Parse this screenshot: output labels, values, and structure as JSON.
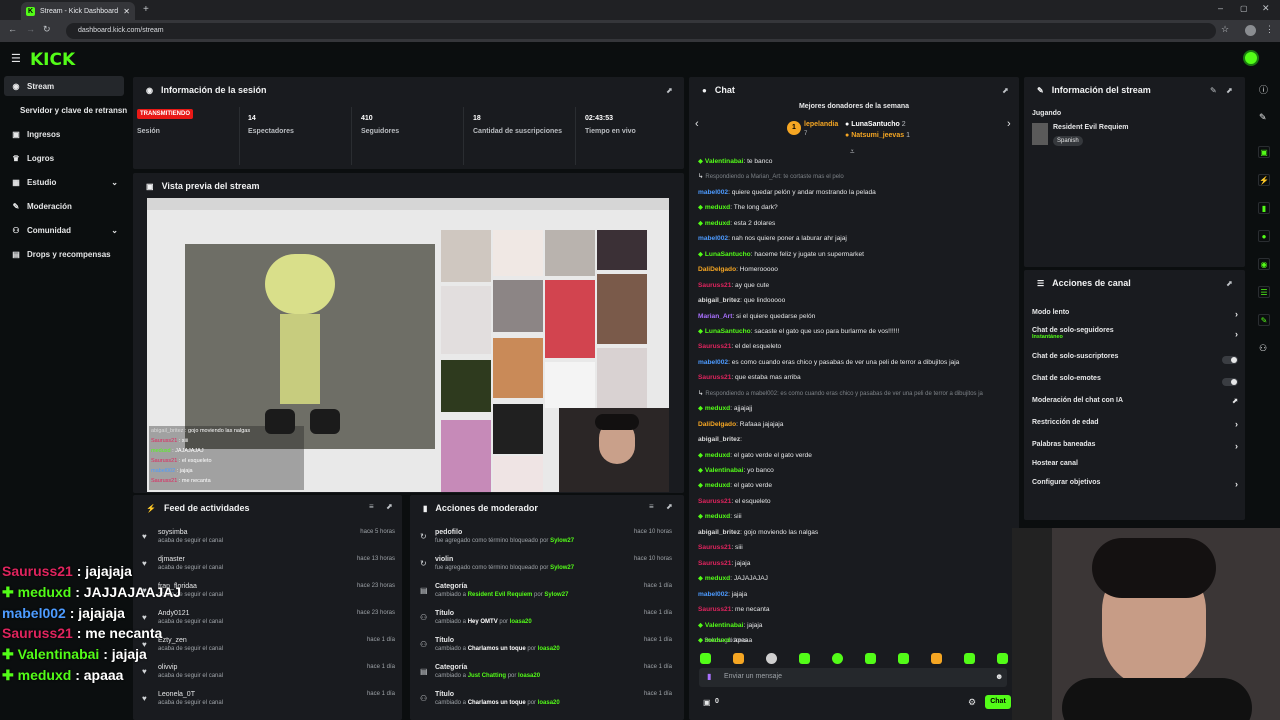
{
  "browser": {
    "tab_title": "Stream - Kick Dashboard",
    "url": "dashboard.kick.com/stream"
  },
  "brand": {
    "logo": "KICK",
    "accent": "#53fc18"
  },
  "sidebar": {
    "items": [
      {
        "label": "Stream",
        "icon": "broadcast-icon"
      },
      {
        "label": "Servidor y clave de retransn",
        "icon": ""
      },
      {
        "label": "Ingresos",
        "icon": "money-icon"
      },
      {
        "label": "Logros",
        "icon": "trophy-icon"
      },
      {
        "label": "Estudio",
        "icon": "studio-icon"
      },
      {
        "label": "Moderación",
        "icon": "wrench-icon"
      },
      {
        "label": "Comunidad",
        "icon": "community-icon"
      },
      {
        "label": "Drops y recompensas",
        "icon": "gift-icon"
      }
    ]
  },
  "session": {
    "title": "Información de la sesión",
    "badge": "TRANSMITIENDO",
    "badge_label": "Sesión",
    "stats": [
      {
        "value": "14",
        "label": "Espectadores"
      },
      {
        "value": "410",
        "label": "Seguidores"
      },
      {
        "value": "18",
        "label": "Cantidad de suscripciones"
      },
      {
        "value": "02:43:53",
        "label": "Tiempo en vivo"
      }
    ]
  },
  "preview": {
    "title": "Vista previa del stream",
    "chat_overlay": [
      {
        "user": "abigail_britez",
        "msg": "gojo moviendo las nalgas"
      },
      {
        "user": "Sauruss21",
        "msg": "siii"
      },
      {
        "user": "meduxd",
        "msg": "JAJAJAJAJ"
      },
      {
        "user": "Sauruss21",
        "msg": "el esqueleto"
      },
      {
        "user": "mabel002",
        "msg": "jajaja"
      },
      {
        "user": "Sauruss21",
        "msg": "me necanta"
      }
    ]
  },
  "feed": {
    "title": "Feed de actividades",
    "rows": [
      {
        "name": "soysimba",
        "sub": "acaba de seguir el canal",
        "time": "hace 5 horas"
      },
      {
        "name": "djmaster",
        "sub": "acaba de seguir el canal",
        "time": "hace 13 horas"
      },
      {
        "name": "fran_floridaa",
        "sub": "acaba de seguir el canal",
        "time": "hace 23 horas"
      },
      {
        "name": "Andy0121",
        "sub": "acaba de seguir el canal",
        "time": "hace 23 horas"
      },
      {
        "name": "Ezty_zen",
        "sub": "acaba de seguir el canal",
        "time": "hace 1 día"
      },
      {
        "name": "olivvip",
        "sub": "acaba de seguir el canal",
        "time": "hace 1 día"
      },
      {
        "name": "Leonela_0T",
        "sub": "acaba de seguir el canal",
        "time": "hace 1 día"
      }
    ]
  },
  "mod_actions": {
    "title": "Acciones de moderador",
    "rows": [
      {
        "title": "pedofilo",
        "desc_prefix": "fue agregado como término bloqueado por ",
        "actor": "Sylow27",
        "time": "hace 10 horas",
        "icon": "ban-icon"
      },
      {
        "title": "violin",
        "desc_prefix": "fue agregado como término bloqueado por ",
        "actor": "Sylow27",
        "time": "hace 10 horas",
        "icon": "ban-icon"
      },
      {
        "title": "Categoría",
        "desc_prefix": "cambiado a ",
        "value": "Resident Evil Requiem",
        "by": " por ",
        "actor": "Sylow27",
        "time": "hace 1 día",
        "icon": "category-icon"
      },
      {
        "title": "Título",
        "desc_prefix": "cambiado a ",
        "value": "Hey OMTV",
        "by": " por ",
        "actor": "loasa20",
        "time": "hace 1 día",
        "icon": "title-icon"
      },
      {
        "title": "Título",
        "desc_prefix": "cambiado a ",
        "value": "Charlamos un toque",
        "by": " por ",
        "actor": "loasa20",
        "time": "hace 1 día",
        "icon": "title-icon"
      },
      {
        "title": "Categoría",
        "desc_prefix": "cambiado a ",
        "value": "Just Chatting",
        "by": " por ",
        "actor": "loasa20",
        "time": "hace 1 día",
        "icon": "category-icon"
      },
      {
        "title": "Título",
        "desc_prefix": "cambiado a ",
        "value": "Charlamos un toque",
        "by": " por ",
        "actor": "loasa20",
        "time": "hace 1 día",
        "icon": "title-icon"
      }
    ]
  },
  "chat": {
    "title": "Chat",
    "donors_title": "Mejores donadores de la semana",
    "donors": [
      {
        "name": "lepelandia",
        "amount": "7"
      },
      {
        "name": "LunaSantucho",
        "amount": "2"
      },
      {
        "name": "Natsumi_jeevas",
        "amount": "1"
      }
    ],
    "lines": [
      {
        "user": "Valentinabai",
        "color": "#53fc18",
        "msg": "te banco",
        "system": false
      },
      {
        "user": "",
        "color": "#7d8287",
        "msg": "Respondiendo a Marian_Art: te cortaste mas el pelo",
        "system": true
      },
      {
        "user": "mabel002",
        "color": "#4d9bff",
        "msg": "quiere quedar pelón y andar mostrando la pelada",
        "system": false
      },
      {
        "user": "meduxd",
        "color": "#53fc18",
        "msg": "The long dark?",
        "system": false
      },
      {
        "user": "meduxd",
        "color": "#53fc18",
        "msg": "esta 2 dolares",
        "system": false
      },
      {
        "user": "mabel002",
        "color": "#4d9bff",
        "msg": "nah nos quiere poner a laburar ahr jajaj",
        "system": false
      },
      {
        "user": "LunaSantucho",
        "color": "#53fc18",
        "msg": "haceme feliz y jugate un supermarket",
        "system": false
      },
      {
        "user": "DaliDelgado",
        "color": "#f5a623",
        "msg": "Homerooooo",
        "system": false
      },
      {
        "user": "Sauruss21",
        "color": "#e0245e",
        "msg": "ay que cute",
        "system": false
      },
      {
        "user": "abigail_britez",
        "color": "#d9d9d9",
        "msg": "que lindooooo",
        "system": false
      },
      {
        "user": "Marian_Art",
        "color": "#a970ff",
        "msg": "si el quiere quedarse pelón",
        "system": false
      },
      {
        "user": "LunaSantucho",
        "color": "#53fc18",
        "msg": "sacaste el gato que uso para burlarme de vos!!!!!!",
        "system": false
      },
      {
        "user": "Sauruss21",
        "color": "#e0245e",
        "msg": "el del esqueleto",
        "system": false
      },
      {
        "user": "mabel002",
        "color": "#4d9bff",
        "msg": "es como cuando eras chico y pasabas de ver una peli de terror a dibujitos jaja",
        "system": false
      },
      {
        "user": "Sauruss21",
        "color": "#e0245e",
        "msg": "que estaba mas arriba",
        "system": false
      },
      {
        "user": "",
        "color": "#7d8287",
        "msg": "Respondiendo a mabel002: es como cuando eras chico y pasabas de ver una peli de terror a dibujitos ja",
        "system": true
      },
      {
        "user": "meduxd",
        "color": "#53fc18",
        "msg": "ajjajajj",
        "system": false
      },
      {
        "user": "DaliDelgado",
        "color": "#f5a623",
        "msg": "Rafaaa jajajaja",
        "system": false
      },
      {
        "user": "abigail_britez",
        "color": "#d9d9d9",
        "msg": "",
        "system": false
      },
      {
        "user": "meduxd",
        "color": "#53fc18",
        "msg": "el gato verde el gato verde",
        "system": false
      },
      {
        "user": "Valentinabai",
        "color": "#53fc18",
        "msg": "yo banco",
        "system": false
      },
      {
        "user": "meduxd",
        "color": "#53fc18",
        "msg": "el gato verde",
        "system": false
      },
      {
        "user": "Sauruss21",
        "color": "#e0245e",
        "msg": "el esqueleto",
        "system": false
      },
      {
        "user": "meduxd",
        "color": "#53fc18",
        "msg": "siii",
        "system": false
      },
      {
        "user": "abigail_britez",
        "color": "#d9d9d9",
        "msg": "gojo moviendo las nalgas",
        "system": false
      },
      {
        "user": "Sauruss21",
        "color": "#e0245e",
        "msg": "siii",
        "system": false
      },
      {
        "user": "Sauruss21",
        "color": "#e0245e",
        "msg": "jajaja",
        "system": false
      },
      {
        "user": "meduxd",
        "color": "#53fc18",
        "msg": "JAJAJAJAJ",
        "system": false
      },
      {
        "user": "mabel002",
        "color": "#4d9bff",
        "msg": "jajaja",
        "system": false
      },
      {
        "user": "Sauruss21",
        "color": "#e0245e",
        "msg": "me necanta",
        "system": false
      },
      {
        "user": "Valentinabai",
        "color": "#53fc18",
        "msg": "jajaja",
        "system": false
      },
      {
        "user": "meduxd",
        "color": "#53fc18",
        "msg": "apaaa",
        "system": false
      }
    ],
    "followers_only": "Solo seguidores",
    "input_placeholder": "Enviar un mensaje",
    "count": "0",
    "send_label": "Chat"
  },
  "stream_info": {
    "title": "Información del stream",
    "playing_label": "Jugando",
    "game": "Resident Evil Requiem",
    "language": "Spanish"
  },
  "channel_actions": {
    "title": "Acciones de canal",
    "items": [
      {
        "label": "Modo lento",
        "control": "chevron",
        "sub": ""
      },
      {
        "label": "Chat de solo-seguidores",
        "control": "chevron",
        "sub": "Instantáneo"
      },
      {
        "label": "Chat de solo-suscriptores",
        "control": "toggle",
        "sub": ""
      },
      {
        "label": "Chat de solo-emotes",
        "control": "toggle",
        "sub": ""
      },
      {
        "label": "Moderación del chat con IA",
        "control": "external",
        "sub": ""
      },
      {
        "label": "Restricción de edad",
        "control": "chevron",
        "sub": ""
      },
      {
        "label": "Palabras baneadas",
        "control": "chevron",
        "sub": ""
      },
      {
        "label": "Hostear canal",
        "control": "none",
        "sub": ""
      },
      {
        "label": "Configurar objetivos",
        "control": "chevron",
        "sub": ""
      }
    ]
  },
  "stream_overlay": {
    "lines": [
      {
        "user": "Sauruss21",
        "msg": " : jajajaja",
        "color": "#e0245e"
      },
      {
        "user": "meduxd",
        "msg": " : JAJJAJAAJAJ",
        "color": "#53fc18"
      },
      {
        "user": "mabel002",
        "msg": " : jajajaja",
        "color": "#4d9bff"
      },
      {
        "user": "Sauruss21",
        "msg": " : me necanta",
        "color": "#e0245e"
      },
      {
        "user": "Valentinabai",
        "msg": " : jajaja",
        "color": "#53fc18"
      },
      {
        "user": "meduxd",
        "msg": " : apaaa",
        "color": "#53fc18"
      }
    ]
  }
}
